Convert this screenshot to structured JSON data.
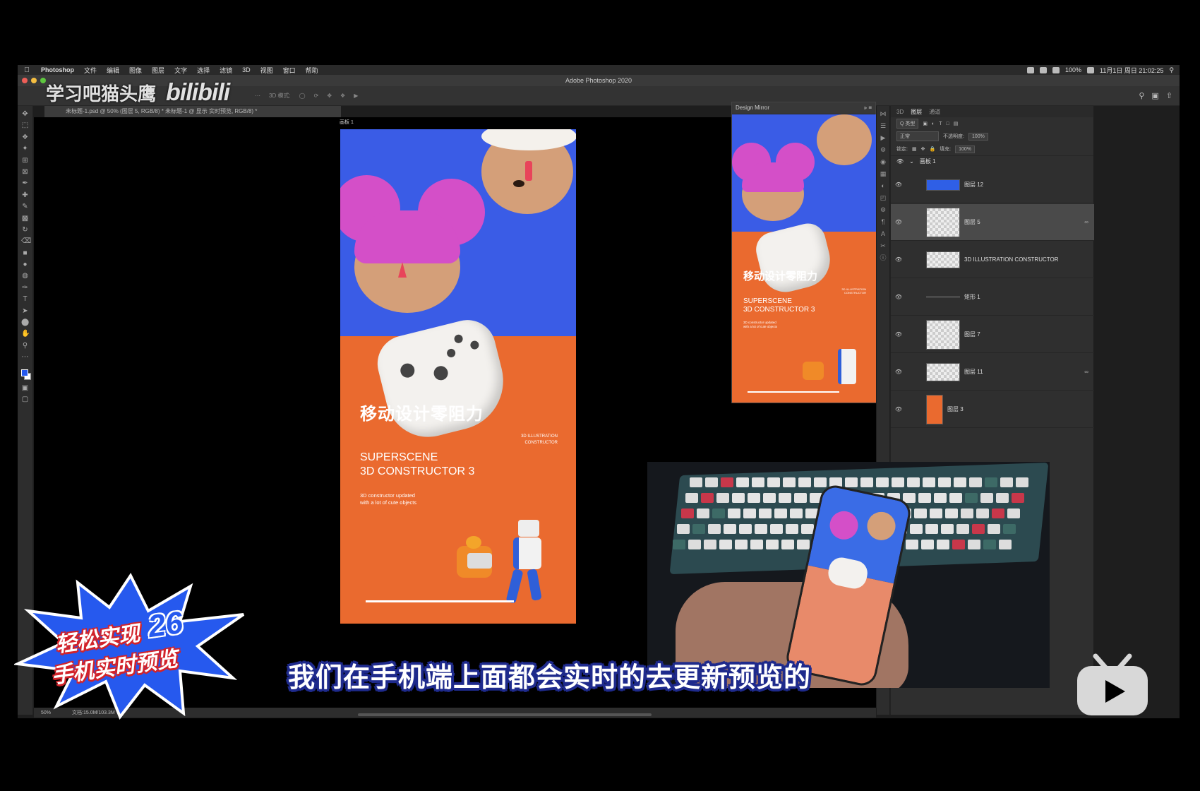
{
  "menubar": {
    "app": "Photoshop",
    "menus": [
      "文件",
      "编辑",
      "图像",
      "图层",
      "文字",
      "选择",
      "滤镜",
      "3D",
      "视图",
      "窗口",
      "帮助"
    ],
    "battery": "100%",
    "datetime": "11月1日 周日 21:02:25"
  },
  "window": {
    "title": "Adobe Photoshop 2020"
  },
  "options_bar": {
    "mode_label": "3D 模式:"
  },
  "doc_tab": {
    "label": "未标题-1.psd @ 50% (图层 5, RGB/8) *   未标题-1 @ 显示 实时预览, RGB/8) *"
  },
  "watermark": {
    "text": "学习吧猫头鹰",
    "brand": "bilibili"
  },
  "artboard": {
    "label": "画板 1",
    "headline": "移动设计零阻力",
    "small_caption": "3D ILLUSTRATION CONSTRUCTOR",
    "title_line1": "SUPERSCENE",
    "title_line2": "3D CONSTRUCTOR 3",
    "desc_line1": "3D constructor updated",
    "desc_line2": "with a lot of cute objects"
  },
  "mirror_panel": {
    "title": "Design Mirror",
    "headline": "移动设计零阻力",
    "small_caption": "3D ILLUSTRATION CONSTRUCTOR",
    "title_line1": "SUPERSCENE",
    "title_line2": "3D CONSTRUCTOR 3",
    "desc_line1": "3D constructor updated",
    "desc_line2": "with a lot of cute objects"
  },
  "layers_panel": {
    "tabs": [
      "3D",
      "图层",
      "通道"
    ],
    "filter_label": "Q 类型",
    "blend_mode": "正常",
    "opacity_label": "不透明度:",
    "opacity_value": "100%",
    "lock_label": "锁定:",
    "fill_label": "填充:",
    "fill_value": "100%",
    "group": "画板 1",
    "layers": [
      {
        "name": "图层 12"
      },
      {
        "name": "图层 5"
      },
      {
        "name": "3D ILLUSTRATION CONSTRUCTOR"
      },
      {
        "name": "矩形 1"
      },
      {
        "name": "图层 7"
      },
      {
        "name": "图层 11"
      },
      {
        "name": "图层 3"
      }
    ]
  },
  "status_bar": {
    "zoom": "50%",
    "doc_size": "文档:15.0M/103.3M"
  },
  "subtitle": "我们在手机端上面都会实时的去更新预览的",
  "badge": {
    "line1": "轻松实现",
    "number": "26",
    "line2": "手机实时预览"
  },
  "colors": {
    "blue": "#3a5ce6",
    "orange": "#ea6a2f",
    "pink": "#d44fc8",
    "accent": "#2659ee"
  }
}
